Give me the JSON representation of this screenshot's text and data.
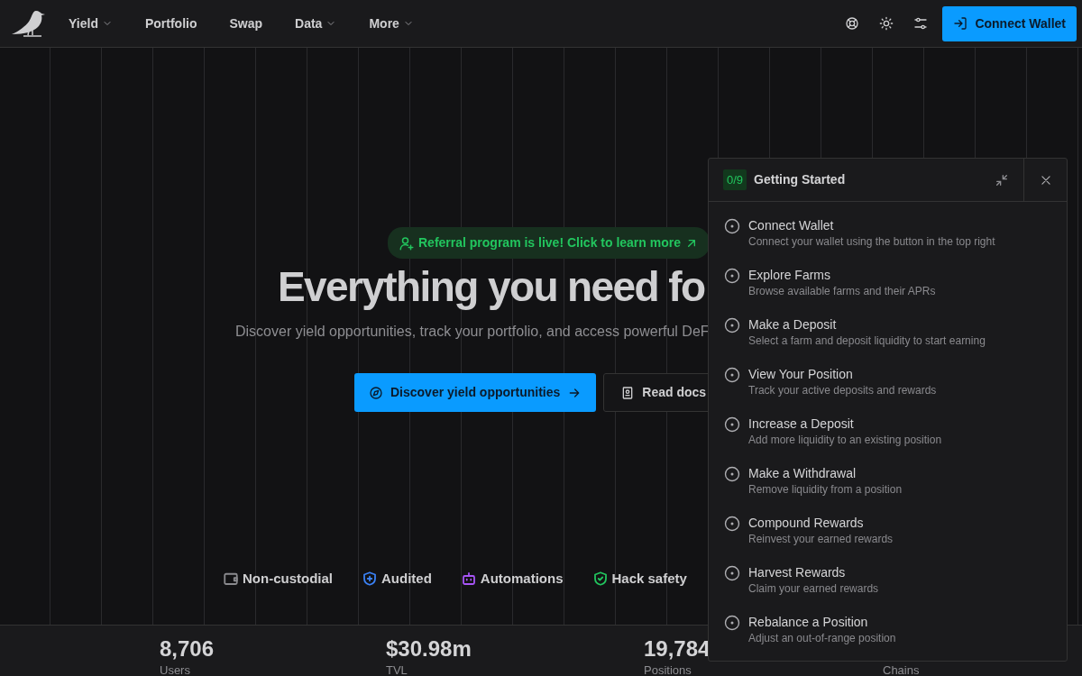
{
  "nav": {
    "items": [
      {
        "label": "Yield",
        "dropdown": true
      },
      {
        "label": "Portfolio",
        "dropdown": false
      },
      {
        "label": "Swap",
        "dropdown": false
      },
      {
        "label": "Data",
        "dropdown": true
      },
      {
        "label": "More",
        "dropdown": true
      }
    ],
    "connect_button": "Connect Wallet"
  },
  "hero": {
    "banner": "Referral program is live! Click to learn more",
    "title": "Everything you need fo",
    "subtitle": "Discover yield opportunities, track your portfolio, and access powerful DeF",
    "primary_button": "Discover yield opportunities",
    "secondary_button": "Read docs"
  },
  "features": [
    {
      "label": "Non-custodial",
      "color": "#8a8a8e"
    },
    {
      "label": "Audited",
      "color": "#3b82f6"
    },
    {
      "label": "Automations",
      "color": "#a855f7"
    },
    {
      "label": "Hack safety",
      "color": "#22c55e"
    }
  ],
  "stats": [
    {
      "value": "8,706",
      "label": "Users"
    },
    {
      "value": "$30.98m",
      "label": "TVL"
    },
    {
      "value": "19,784",
      "label": "Positions"
    },
    {
      "label": "Chains"
    }
  ],
  "getting_started": {
    "progress": "0/9",
    "title": "Getting Started",
    "steps": [
      {
        "title": "Connect Wallet",
        "description": "Connect your wallet using the button in the top right",
        "done": false
      },
      {
        "title": "Explore Farms",
        "description": "Browse available farms and their APRs",
        "done": false
      },
      {
        "title": "Make a Deposit",
        "description": "Select a farm and deposit liquidity to start earning",
        "done": false
      },
      {
        "title": "View Your Position",
        "description": "Track your active deposits and rewards",
        "done": false
      },
      {
        "title": "Increase a Deposit",
        "description": "Add more liquidity to an existing position",
        "done": false
      },
      {
        "title": "Make a Withdrawal",
        "description": "Remove liquidity from a position",
        "done": false
      },
      {
        "title": "Compound Rewards",
        "description": "Reinvest your earned rewards",
        "done": false
      },
      {
        "title": "Harvest Rewards",
        "description": "Claim your earned rewards",
        "done": false
      },
      {
        "title": "Rebalance a Position",
        "description": "Adjust an out-of-range position",
        "done": false
      }
    ]
  }
}
